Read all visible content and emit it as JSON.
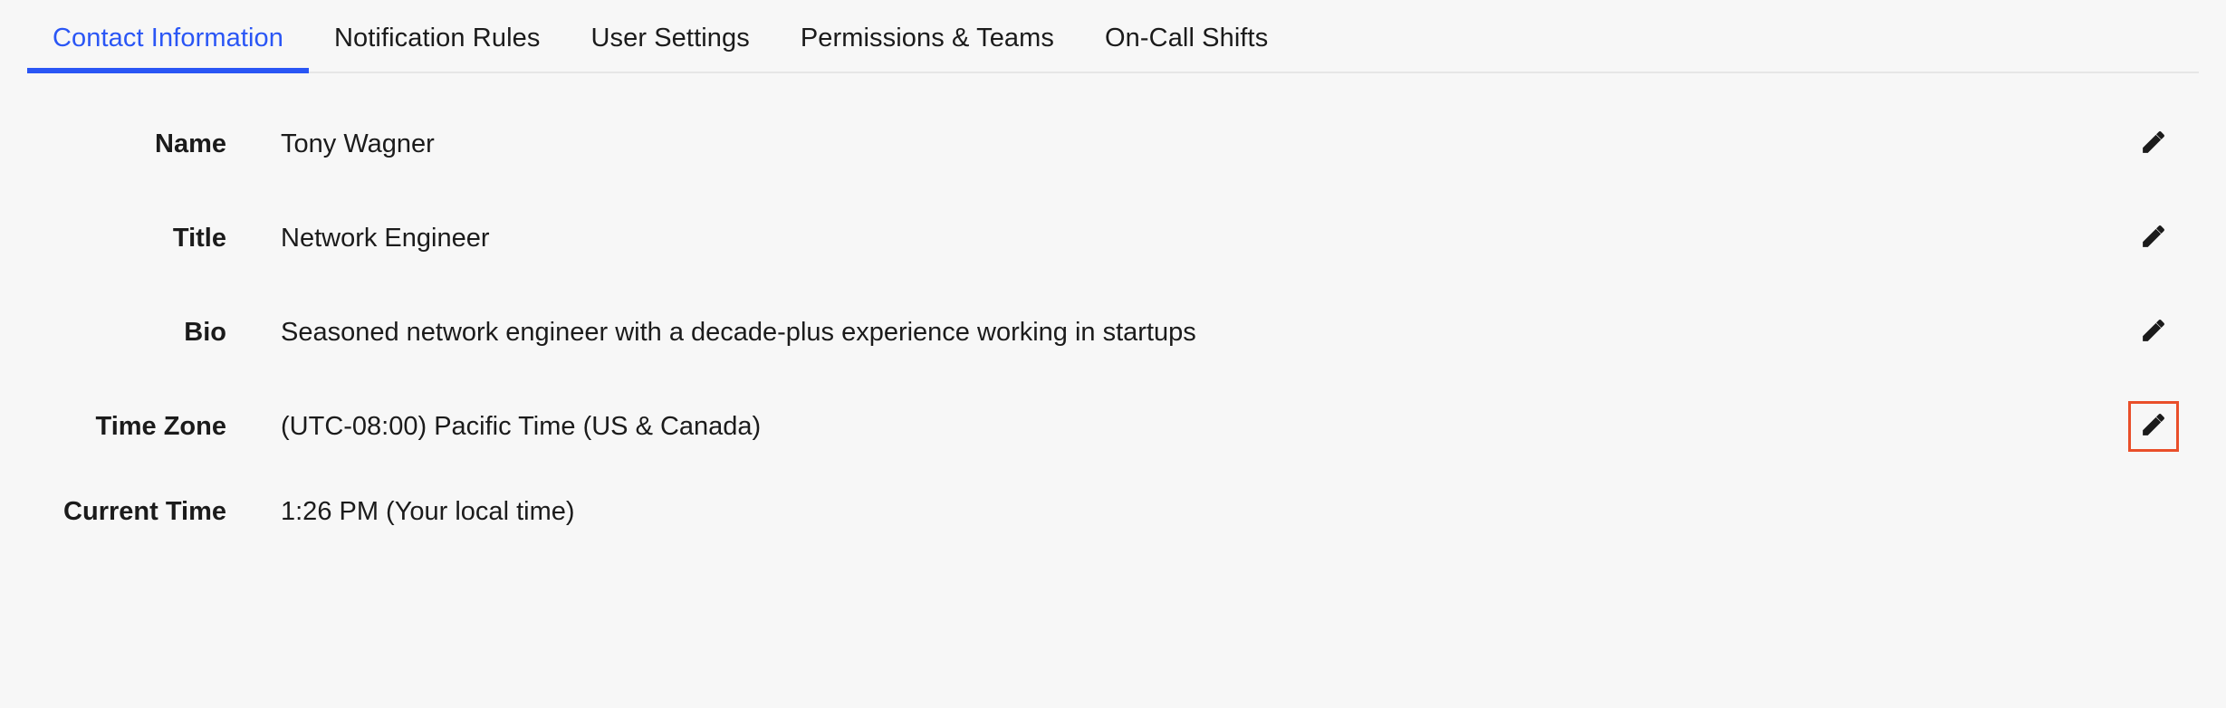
{
  "tabs": [
    {
      "label": "Contact Information",
      "active": true
    },
    {
      "label": "Notification Rules",
      "active": false
    },
    {
      "label": "User Settings",
      "active": false
    },
    {
      "label": "Permissions & Teams",
      "active": false
    },
    {
      "label": "On-Call Shifts",
      "active": false
    }
  ],
  "fields": {
    "name": {
      "label": "Name",
      "value": "Tony Wagner",
      "editable": true,
      "highlighted": false
    },
    "title": {
      "label": "Title",
      "value": "Network Engineer",
      "editable": true,
      "highlighted": false
    },
    "bio": {
      "label": "Bio",
      "value": "Seasoned network engineer with a decade-plus experience working in startups",
      "editable": true,
      "highlighted": false
    },
    "timezone": {
      "label": "Time Zone",
      "value": "(UTC-08:00) Pacific Time (US & Canada)",
      "editable": true,
      "highlighted": true
    },
    "currenttime": {
      "label": "Current Time",
      "value": "1:26 PM (Your local time)",
      "editable": false,
      "highlighted": false
    }
  }
}
